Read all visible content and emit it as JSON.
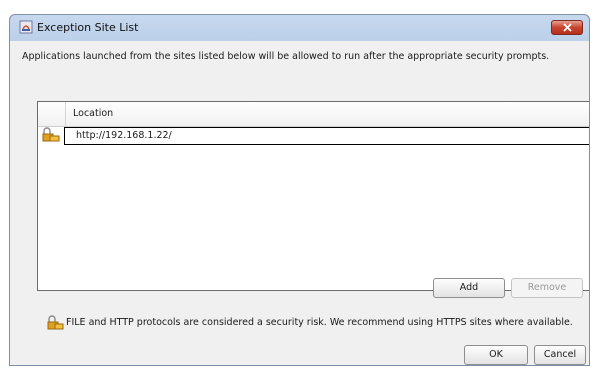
{
  "window": {
    "title": "Exception Site List",
    "intro": "Applications launched from the sites listed below will be allowed to run after the appropriate security prompts."
  },
  "table": {
    "column_header": "Location",
    "rows": [
      {
        "location": "http://192.168.1.22/",
        "icon": "lock-warning-icon"
      }
    ]
  },
  "buttons": {
    "add": "Add",
    "remove": "Remove",
    "ok": "OK",
    "cancel": "Cancel"
  },
  "warning": {
    "text": "FILE and HTTP protocols are considered a security risk.  We recommend using HTTPS sites where available.",
    "icon": "lock-warning-icon"
  },
  "colors": {
    "titlebar": "#bcd0ea",
    "close": "#c8452e",
    "panel": "#f0f0f0"
  }
}
